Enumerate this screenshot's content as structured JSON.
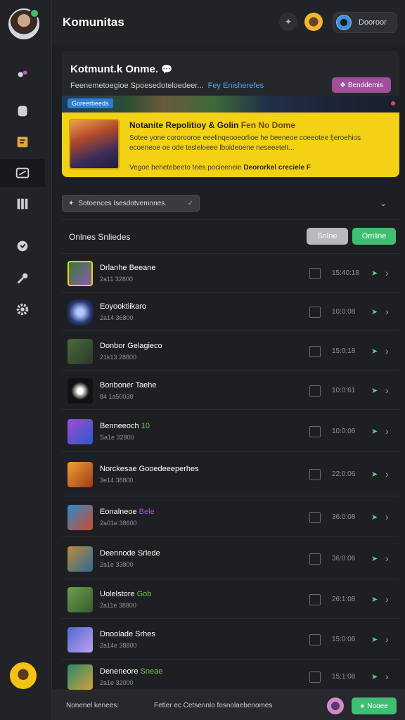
{
  "header": {
    "title": "Komunitas",
    "profile_label": "Dooroor"
  },
  "banner": {
    "title": "Kotmunt.k Onme.",
    "subtitle": "Feenemetoegioe Spoesedoteloedeer...",
    "subtitle_link": "Fey Enisherefes",
    "action_label": "❖ Benddemis",
    "strip_tag": "Goreerbeeds"
  },
  "promo": {
    "title": "Notanite Repolitioy & Golin",
    "title_hl": "Fen No Dome",
    "text": "Sotee yone cororooroe eeelinqeooeorlioe he beeneoe coeeotee fjeroehios ecoeneoe oe ode tesleloeee lboideoene neseeetelt...",
    "footer_label": "Vegoe behetebeeto tees pocieeneie",
    "footer_hl": "Deororkel creciele F"
  },
  "filter": {
    "label": "Sotoences Isesdotvemnnes."
  },
  "list_section": {
    "title": "Onlnes Snliedes",
    "secondary_btn": "Snlne",
    "primary_btn": "Omline"
  },
  "rows": [
    {
      "name": "Drlanhe Beeane",
      "hl": "",
      "sub": "2a11 32800",
      "time": "15:40:18"
    },
    {
      "name": "Eoyooktiikaro",
      "hl": "",
      "sub": "2a14 36800",
      "time": "10:0:08"
    },
    {
      "name": "Donbor Gelagieco",
      "hl": "",
      "sub": "21k13 28800",
      "time": "15:0:18"
    },
    {
      "name": "Bonboner Taehe",
      "hl": "",
      "sub": "84 1a50030",
      "time": "10:0:61"
    },
    {
      "name": "Benneeoch",
      "hl": "10",
      "sub": "Sa1e 32800",
      "time": "10:0:06"
    },
    {
      "name": "Norckesae Gooedeeeperhes",
      "hl": "",
      "sub": "3e14 38800",
      "time": "22:0:06"
    },
    {
      "name": "Eonalneoe",
      "hl": "Bele",
      "sub": "2a01e 38600",
      "time": "36:0:08"
    },
    {
      "name": "Deennode Srlede",
      "hl": "",
      "sub": "2a1e 33800",
      "time": "36:0:06"
    },
    {
      "name": "Uolelstore",
      "hl": "Gob",
      "sub": "2a11e 38800",
      "time": "26:1:08"
    },
    {
      "name": "Dnoolade Srhes",
      "hl": "",
      "sub": "2a14e 38800",
      "time": "15:0:06"
    },
    {
      "name": "Deneneore",
      "hl": "Sneae",
      "sub": "2a1e 32000",
      "time": "15:1:08"
    }
  ],
  "footer": {
    "left_text": "Nonenel kenees:",
    "mid_text": "Fetler ec Cetsennlo fosnolaebenomes",
    "button": "Nooee"
  }
}
